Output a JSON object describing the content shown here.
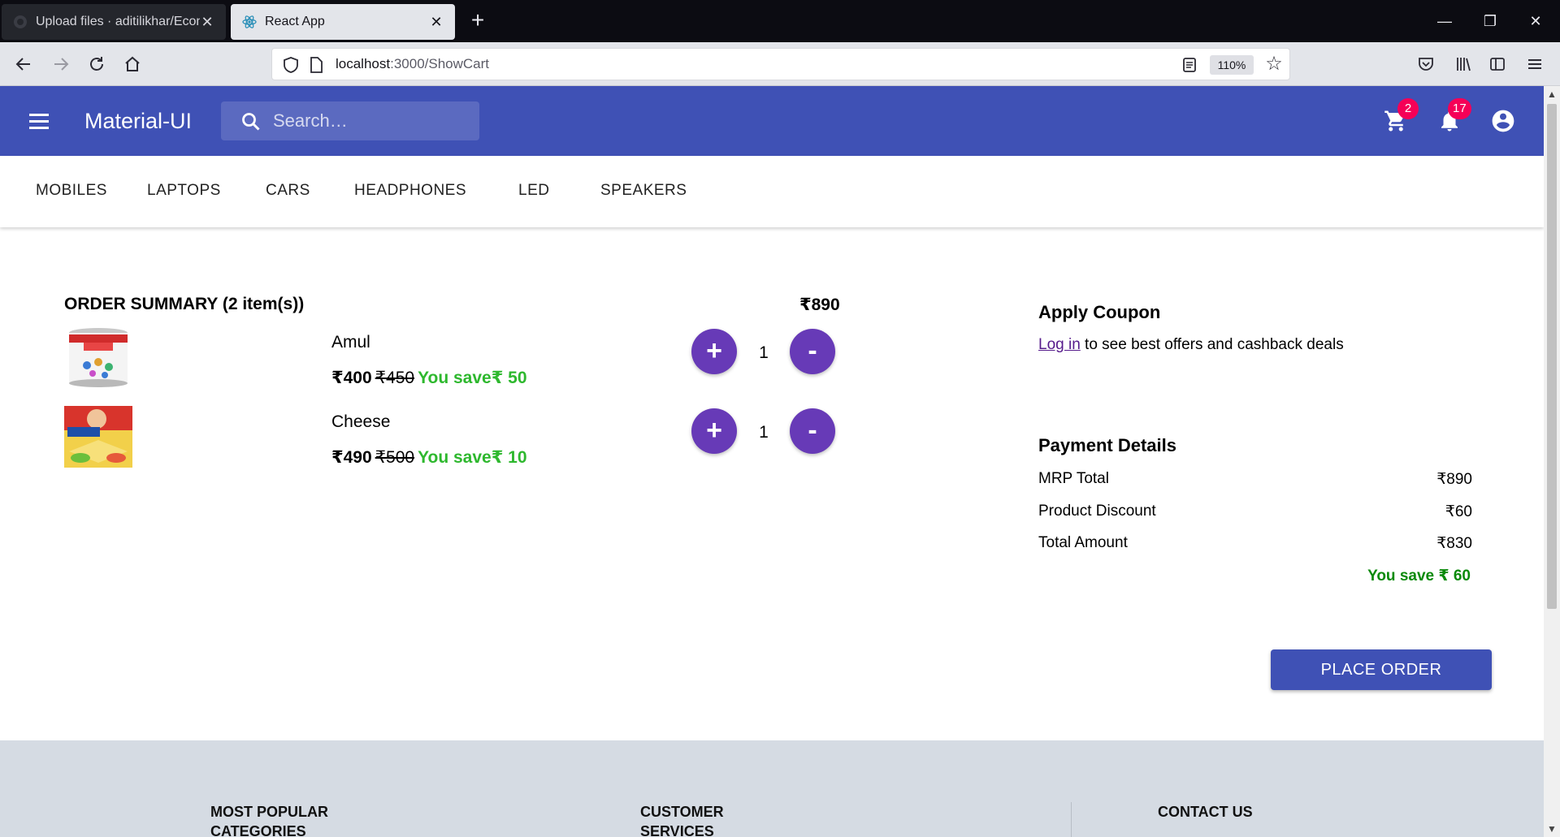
{
  "browser": {
    "tabs": [
      {
        "title": "Upload files · aditilikhar/Ecomm",
        "active": false
      },
      {
        "title": "React App",
        "active": true
      }
    ],
    "url_host": "localhost",
    "url_path": ":3000/ShowCart",
    "zoom": "110%"
  },
  "appbar": {
    "brand": "Material-UI",
    "search_placeholder": "Search…",
    "cart_badge": "2",
    "notifications_badge": "17",
    "color": "#3f51b5"
  },
  "categories": [
    "MOBILES",
    "LAPTOPS",
    "CARS",
    "HEADPHONES",
    "LED",
    "SPEAKERS"
  ],
  "order": {
    "title": "ORDER SUMMARY (2 item(s))",
    "total": "₹890",
    "items": [
      {
        "name": "Amul",
        "price": "₹400",
        "mrp": "₹450",
        "save": "You save₹ 50",
        "qty": "1",
        "plus": "+",
        "minus": "-"
      },
      {
        "name": "Cheese",
        "price": "₹490",
        "mrp": "₹500",
        "save": "You save₹ 10",
        "qty": "1",
        "plus": "+",
        "minus": "-"
      }
    ]
  },
  "coupon": {
    "title": "Apply Coupon",
    "login_link": "Log in",
    "text": " to see best offers and cashback deals"
  },
  "payment": {
    "title": "Payment Details",
    "rows": [
      {
        "label": "MRP Total",
        "value": "₹890"
      },
      {
        "label": "Product Discount",
        "value": "₹60"
      },
      {
        "label": "Total Amount",
        "value": "₹830"
      }
    ],
    "save": "You save ₹ 60"
  },
  "place_order_label": "PLACE ORDER",
  "footer": {
    "col1": "MOST POPULAR CATEGORIES",
    "col2": "CUSTOMER SERVICES",
    "col3": "CONTACT US"
  }
}
